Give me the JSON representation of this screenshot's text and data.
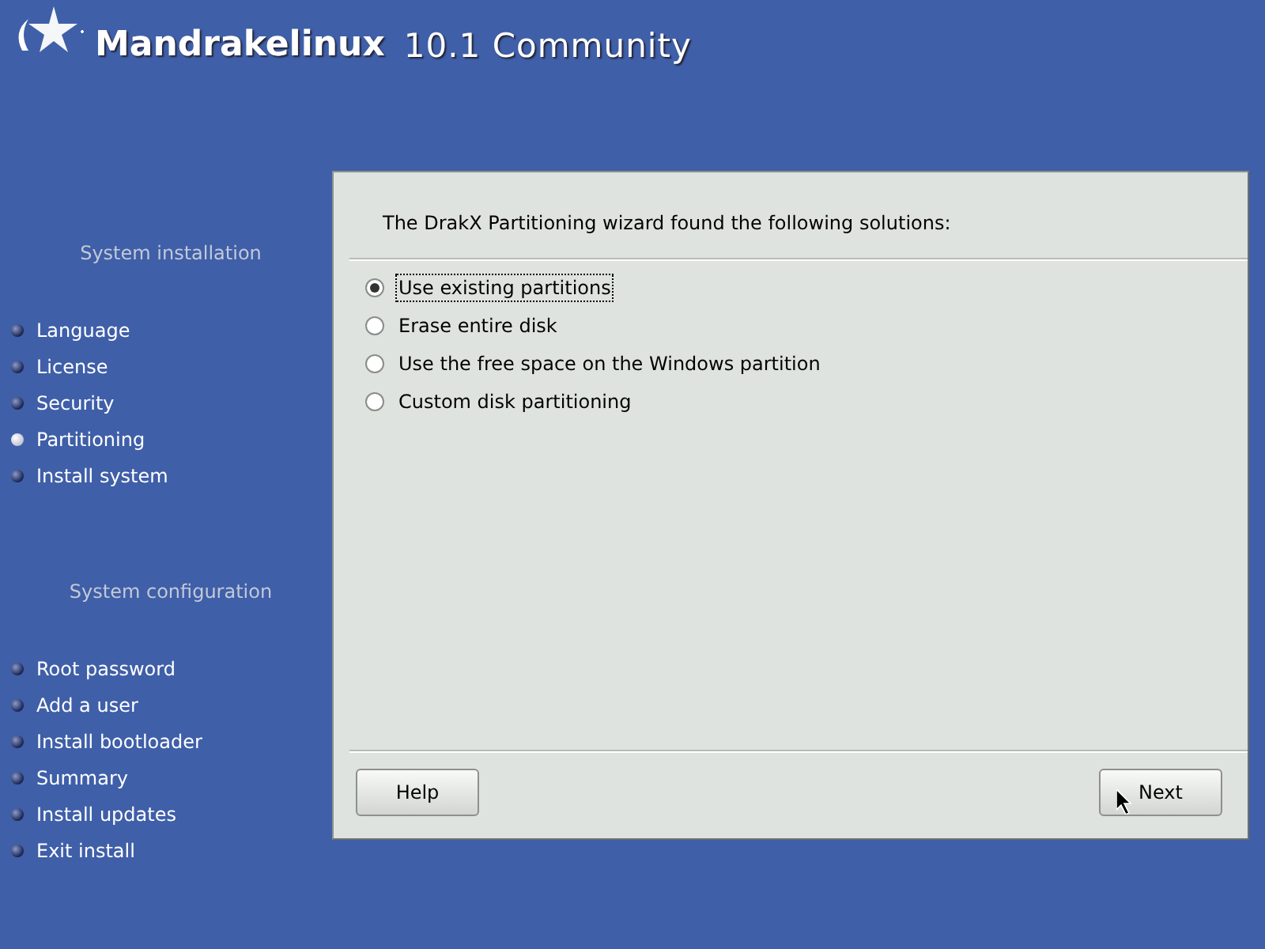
{
  "header": {
    "brand": "Mandrakelinux",
    "version": "10.1 Community"
  },
  "sidebar": {
    "sections": [
      {
        "title": "System installation",
        "items": [
          {
            "label": "Language",
            "selected": false
          },
          {
            "label": "License",
            "selected": false
          },
          {
            "label": "Security",
            "selected": false
          },
          {
            "label": "Partitioning",
            "selected": true
          },
          {
            "label": "Install system",
            "selected": false
          }
        ]
      },
      {
        "title": "System configuration",
        "items": [
          {
            "label": "Root password",
            "selected": false
          },
          {
            "label": "Add a user",
            "selected": false
          },
          {
            "label": "Install bootloader",
            "selected": false
          },
          {
            "label": "Summary",
            "selected": false
          },
          {
            "label": "Install updates",
            "selected": false
          },
          {
            "label": "Exit install",
            "selected": false
          }
        ]
      }
    ]
  },
  "panel": {
    "message": "The DrakX Partitioning wizard found the following solutions:",
    "options": [
      {
        "label": "Use existing partitions",
        "selected": true
      },
      {
        "label": "Erase entire disk",
        "selected": false
      },
      {
        "label": "Use the free space on the Windows partition",
        "selected": false
      },
      {
        "label": "Custom disk partitioning",
        "selected": false
      }
    ],
    "buttons": [
      "Help",
      "Next"
    ]
  }
}
